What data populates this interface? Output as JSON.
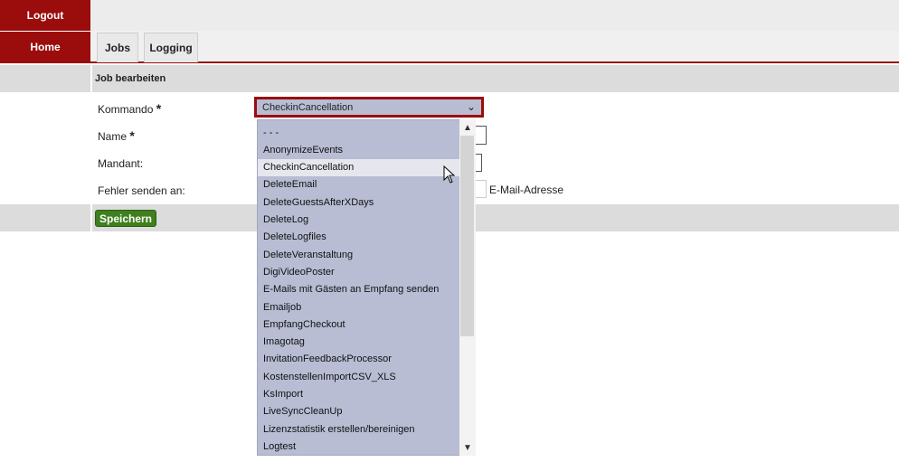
{
  "nav": {
    "logout": "Logout",
    "home": "Home"
  },
  "tabs": [
    {
      "label": "Jobs"
    },
    {
      "label": "Logging"
    }
  ],
  "form": {
    "section_title": "Job bearbeiten",
    "kommando_label": "Kommando",
    "name_label": "Name",
    "mandant_label": "Mandant:",
    "fehler_label": "Fehler senden an:",
    "email_label": "E-Mail-Adresse",
    "required_mark": "*",
    "selected_command": "CheckinCancellation",
    "save_label": "Speichern"
  },
  "dropdown": {
    "selected_index": 2,
    "options": [
      "- - -",
      "AnonymizeEvents",
      "CheckinCancellation",
      "DeleteEmail",
      "DeleteGuestsAfterXDays",
      "DeleteLog",
      "DeleteLogfiles",
      "DeleteVeranstaltung",
      "DigiVideoPoster",
      "E-Mails mit Gästen an Empfang senden",
      "Emailjob",
      "EmpfangCheckout",
      "Imagotag",
      "InvitationFeedbackProcessor",
      "KostenstellenImportCSV_XLS",
      "KsImport",
      "LiveSyncCleanUp",
      "Lizenzstatistik erstellen/bereinigen",
      "Logtest"
    ]
  },
  "icons": {
    "chevron": "chevron-down-icon",
    "cursor": "mouse-pointer-icon"
  },
  "colors": {
    "brand": "#9b0c0c",
    "save": "#3f7f1e",
    "dropdown_bg": "#b8bdd4"
  }
}
